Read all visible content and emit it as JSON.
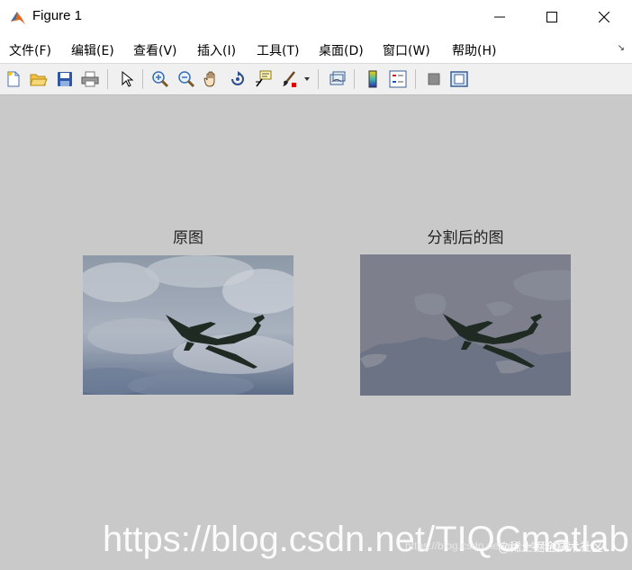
{
  "window": {
    "title": "Figure 1"
  },
  "menu": {
    "items": [
      "文件(F)",
      "编辑(E)",
      "查看(V)",
      "插入(I)",
      "工具(T)",
      "桌面(D)",
      "窗口(W)",
      "帮助(H)"
    ]
  },
  "toolbar": {
    "icons": [
      "new-figure-icon",
      "open-file-icon",
      "save-icon",
      "print-icon",
      "pointer-icon",
      "zoom-in-icon",
      "zoom-out-icon",
      "pan-hand-icon",
      "rotate-3d-icon",
      "data-cursor-icon",
      "brush-icon",
      "link-plot-icon",
      "colorbar-icon",
      "legend-icon",
      "hide-plot-tools-icon",
      "show-plot-tools-icon"
    ]
  },
  "axes": [
    {
      "title": "原图"
    },
    {
      "title": "分割后的图"
    }
  ],
  "colors": {
    "canvas": "#c9c9c9",
    "segmented_bg": "#7d808c",
    "segmented_cloud": "#8a8d97",
    "plane": "#1f2a22"
  },
  "watermark": {
    "main": "https://blog.csdn.net/TIQCmatlab",
    "url_small": "https://blog.csdn.net/qq_34763204",
    "tag": "@稀土掘金技术社区"
  }
}
